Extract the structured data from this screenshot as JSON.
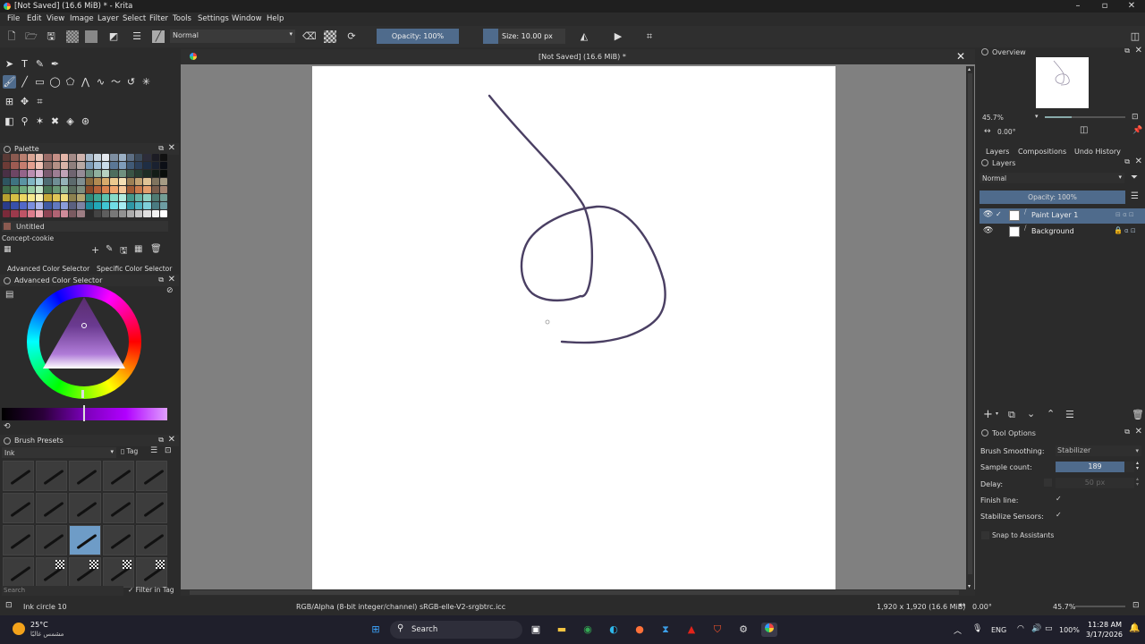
{
  "window": {
    "title": "[Not Saved]  (16.6 MiB) * - Krita"
  },
  "menu": [
    "File",
    "Edit",
    "View",
    "Image",
    "Layer",
    "Select",
    "Filter",
    "Tools",
    "Settings",
    "Window",
    "Help"
  ],
  "toolbar": {
    "blend_mode": "Normal",
    "opacity_label": "Opacity: 100%",
    "size_label": "Size: 10.00 px"
  },
  "document_tab": {
    "title": "[Not Saved]  (16.6 MiB) *"
  },
  "palette": {
    "title": "Palette",
    "name": "Untitled",
    "set_name": "Concept-cookie",
    "swatches": [
      "#5a3a36",
      "#8a5a50",
      "#b87f70",
      "#d9a493",
      "#e8c0b3",
      "#9a6b67",
      "#c58f86",
      "#e3b5a8",
      "#a38a87",
      "#cfb3ad",
      "#a7b8c9",
      "#c8d4de",
      "#e3e8ee",
      "#7d8ea1",
      "#9bb0c4",
      "#5c6e83",
      "#3c4a5a",
      "#2d2d3a",
      "#1c1c24",
      "#111111",
      "#6d3b36",
      "#9c5b52",
      "#c57d6f",
      "#e29f8f",
      "#f1c3b6",
      "#8c6b66",
      "#b59086",
      "#d8b2a6",
      "#8f7f7d",
      "#b8a8a4",
      "#7e9cb8",
      "#a4bfd6",
      "#c9dbe9",
      "#5b7796",
      "#7f9cb9",
      "#415a76",
      "#2d405a",
      "#1f2e44",
      "#1a2130",
      "#0c0f16",
      "#4a3045",
      "#6e4664",
      "#95648a",
      "#ba8db0",
      "#d9b4d0",
      "#7a5a6e",
      "#9d7d93",
      "#c1a2b7",
      "#6f6470",
      "#958b96",
      "#6a8a7a",
      "#8fb09e",
      "#b6d1c2",
      "#4d6e5e",
      "#6f917f",
      "#395445",
      "#283e33",
      "#1d2d25",
      "#121c17",
      "#090e0b",
      "#2e5560",
      "#3f7381",
      "#5a94a3",
      "#80b5c3",
      "#a9d3dd",
      "#4e6b72",
      "#6f8e95",
      "#95b2b9",
      "#5c6a6d",
      "#7f8e91",
      "#8a6a3e",
      "#b28a52",
      "#d6ab6c",
      "#ebc98f",
      "#f5e0b5",
      "#9c7f55",
      "#c2a273",
      "#e0c396",
      "#7f745f",
      "#a69b84",
      "#3f6b4a",
      "#558c62",
      "#72ad7f",
      "#98cba2",
      "#c1e3c7",
      "#4a7656",
      "#6b9876",
      "#91b99b",
      "#5b6c5e",
      "#7d8f80",
      "#8a4a2a",
      "#b5633a",
      "#d8834f",
      "#eea56d",
      "#f6c89a",
      "#a05a34",
      "#c97a4c",
      "#e49e6d",
      "#7a5d4c",
      "#a58572",
      "#b8a030",
      "#d6bf45",
      "#ecd763",
      "#f6e88c",
      "#fbf3bb",
      "#c7a83a",
      "#e0c558",
      "#f0dc7e",
      "#8c8150",
      "#b2a670",
      "#2f8a7a",
      "#3fa895",
      "#5cc3af",
      "#86dac9",
      "#b4ece0",
      "#44978a",
      "#67b4a6",
      "#8ed0c3",
      "#4f7a72",
      "#739d95",
      "#2a3c8a",
      "#3850aa",
      "#5268c7",
      "#7a8ede",
      "#a9b6ee",
      "#4059a2",
      "#6279bf",
      "#8a9cd8",
      "#5a6080",
      "#7d83a3",
      "#1a8a9a",
      "#22a8b8",
      "#40c4d2",
      "#70dbe5",
      "#a6ecf2",
      "#2e97a6",
      "#52b4c2",
      "#7ecfda",
      "#4a7a80",
      "#6d9da3",
      "#7a2a3a",
      "#9c3a4c",
      "#bf5466",
      "#dc7c8c",
      "#f0aab6",
      "#8e4454",
      "#b16474",
      "#cf8c9a",
      "#7a5a60",
      "#9d7d83",
      "#2a2a2a",
      "#444444",
      "#5e5e5e",
      "#787878",
      "#929292",
      "#acacac",
      "#c6c6c6",
      "#e0e0e0",
      "#f2f2f2",
      "#ffffff"
    ]
  },
  "color_selector": {
    "tab1": "Advanced Color Selector",
    "tab2": "Specific Color Selector",
    "title": "Advanced Color Selector"
  },
  "brush_presets": {
    "title": "Brush Presets",
    "filter": "Ink",
    "tag_label": "Tag",
    "search_placeholder": "Search",
    "filter_in_tag": "Filter in Tag"
  },
  "overview": {
    "title": "Overview",
    "zoom": "45.7%",
    "rotation": "0.00°"
  },
  "layers": {
    "tabs": [
      "Layers",
      "Compositions",
      "Undo History"
    ],
    "title": "Layers",
    "blend_mode": "Normal",
    "opacity": "Opacity:  100%",
    "items": [
      {
        "name": "Paint Layer 1",
        "selected": true
      },
      {
        "name": "Background",
        "selected": false
      }
    ]
  },
  "tool_options": {
    "title": "Tool Options",
    "brush_smoothing_label": "Brush Smoothing:",
    "brush_smoothing_value": "Stabilizer",
    "sample_count_label": "Sample count:",
    "sample_count_value": "189",
    "delay_label": "Delay:",
    "delay_value": "50 px",
    "finish_line_label": "Finish line:",
    "stabilize_sensors_label": "Stabilize Sensors:",
    "snap_label": "Snap to Assistants"
  },
  "status": {
    "brush": "Ink circle 10",
    "color_space": "RGB/Alpha (8-bit integer/channel)  sRGB-elle-V2-srgbtrc.icc",
    "dimensions": "1,920 x 1,920 (16.6 MiB)",
    "rotation": "0.00°",
    "zoom": "45.7%"
  },
  "taskbar": {
    "weather_temp": "25°C",
    "weather_desc": "مشمس غالبًا",
    "search_label": "Search",
    "lang": "ENG",
    "battery": "100%",
    "time": "11:28 AM",
    "date": "3/17/2026"
  }
}
